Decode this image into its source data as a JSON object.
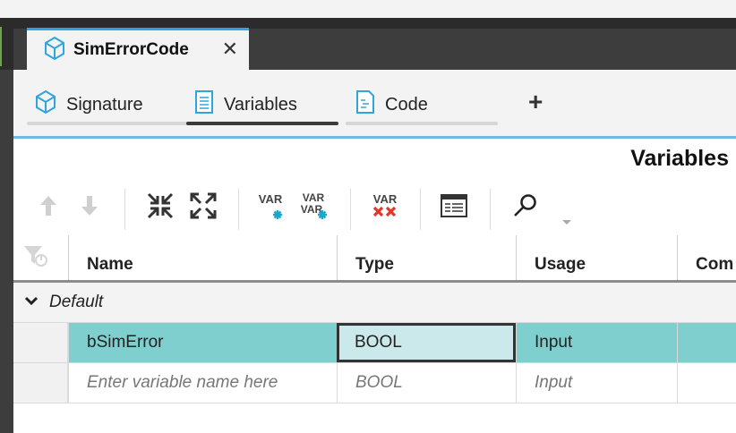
{
  "document_tab": {
    "title": "SimErrorCode",
    "close": "✕"
  },
  "subtabs": [
    {
      "label": "Signature",
      "active": false
    },
    {
      "label": "Variables",
      "active": true
    },
    {
      "label": "Code",
      "active": false
    }
  ],
  "add_tab": "+",
  "panel": {
    "title": "Variables"
  },
  "toolbar": {
    "var_label": "VAR",
    "icons": [
      "arrow-up-icon",
      "arrow-down-icon",
      "collapse-icon",
      "expand-icon",
      "add-variable-icon",
      "copy-variable-icon",
      "delete-variable-icon",
      "declaration-view-icon",
      "search-icon"
    ]
  },
  "grid": {
    "columns": [
      "Name",
      "Type",
      "Usage",
      "Com"
    ],
    "group": "Default",
    "rows": [
      {
        "name": "bSimError",
        "type": "BOOL",
        "usage": "Input"
      }
    ],
    "new_row": {
      "name": "Enter variable name here",
      "type": "BOOL",
      "usage": "Input"
    }
  },
  "colors": {
    "accent": "#2ea5dd",
    "selection": "#7fcfcf",
    "delete": "#e0392b",
    "add": "#1aa7c9"
  }
}
